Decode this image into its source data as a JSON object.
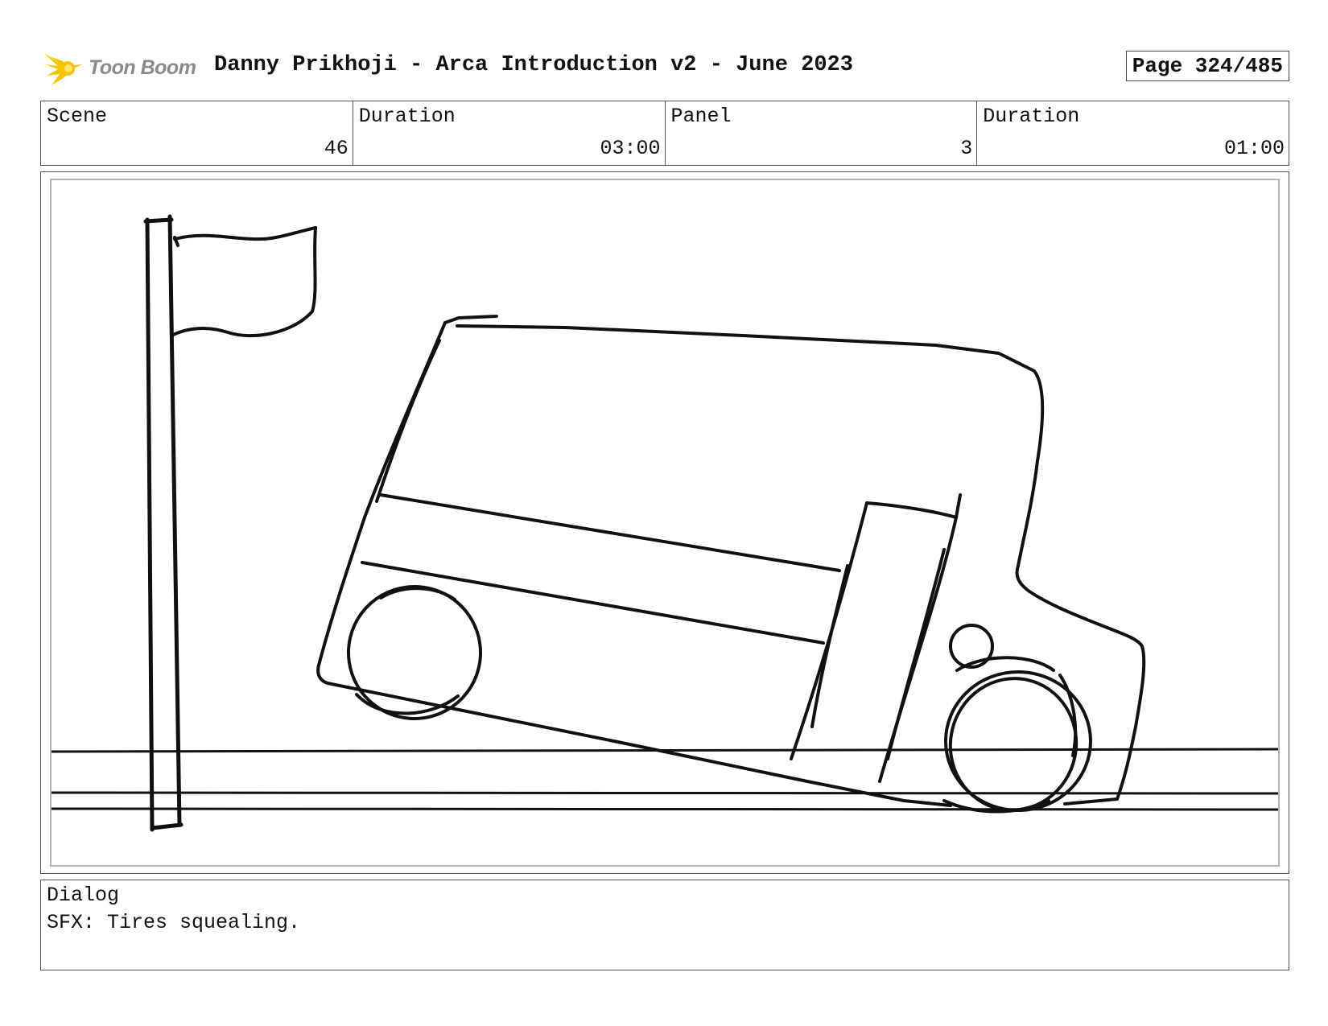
{
  "header": {
    "logo_text": "Toon Boom",
    "title": "Danny Prikhoji - Arca Introduction v2 - June 2023",
    "page": "Page 324/485"
  },
  "info": [
    {
      "label": "Scene",
      "value": "46"
    },
    {
      "label": "Duration",
      "value": "03:00"
    },
    {
      "label": "Panel",
      "value": "3"
    },
    {
      "label": "Duration",
      "value": "01:00"
    }
  ],
  "panel": {
    "sketch": "flag-pole-and-tilted-truck"
  },
  "dialog": {
    "label": "Dialog",
    "text": "SFX: Tires squealing."
  },
  "colors": {
    "logo_flash": "#f5c400",
    "logo_text": "#8a8a8a",
    "ink": "#111111",
    "frame_gray": "#b5b5b5"
  }
}
